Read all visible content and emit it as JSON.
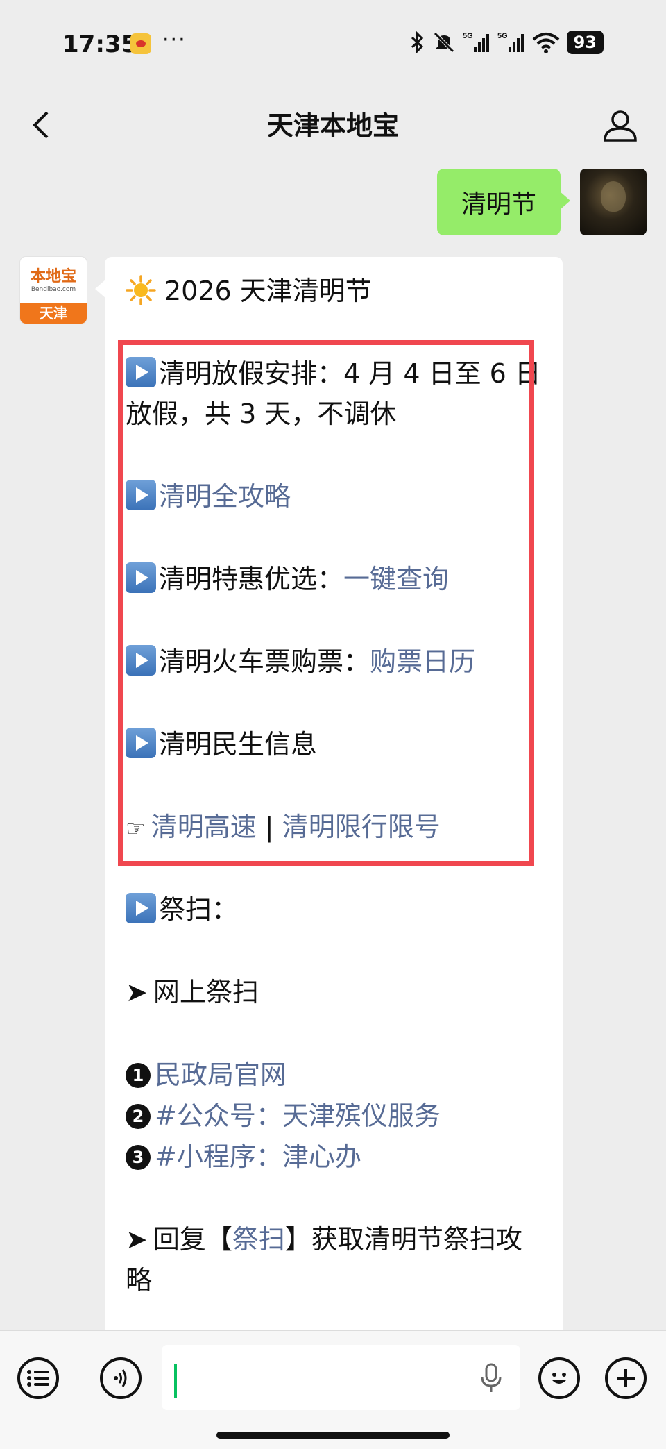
{
  "status_bar": {
    "time": "17:35",
    "dots": "···",
    "battery": "93",
    "icons": [
      "bluetooth-icon",
      "mute-icon",
      "signal-5g-icon",
      "signal-5g-icon",
      "wifi-icon",
      "battery-icon"
    ]
  },
  "nav": {
    "title": "天津本地宝",
    "back_icon": "chevron-left-icon",
    "profile_icon": "person-icon"
  },
  "user_message": {
    "text": "清明节"
  },
  "bot_avatar": {
    "brand": "本地宝",
    "url": "Bendibao.com",
    "city": "天津"
  },
  "bot_message": {
    "title": "2026 天津清明节",
    "holiday_label": "清明放假安排：4 月 4 日至 6 日",
    "holiday_cont": "放假，共 3 天，不调休",
    "guide_link": "清明全攻略",
    "deals_label": "清明特惠优选：",
    "deals_link": "一键查询",
    "train_label": "清明火车票购票：",
    "train_link": "购票日历",
    "livelihood_label": "清明民生信息",
    "highway_link": "清明高速",
    "separator": "|",
    "restriction_link": "清明限行限号",
    "sweep_label": "祭扫：",
    "online_sweep": "网上祭扫",
    "item1_num": "1",
    "item1_link": "民政局官网",
    "item2_num": "2",
    "item2_link": "#公众号：天津殡仪服务",
    "item3_num": "3",
    "item3_link": "#小程序：津心办",
    "reply_prefix": "回复【",
    "reply_keyword": "祭扫",
    "reply_suffix": "】获取清明节祭扫攻",
    "reply_cont": "略"
  },
  "input_bar": {
    "menu_icon": "list-menu-icon",
    "voice_icon": "voice-icon",
    "mic_icon": "mic-icon",
    "emoji_icon": "emoji-icon",
    "plus_icon": "plus-icon"
  },
  "colors": {
    "link": "#576b95",
    "user_bubble": "#95ec69",
    "highlight": "#f0474f",
    "background": "#ededed"
  }
}
